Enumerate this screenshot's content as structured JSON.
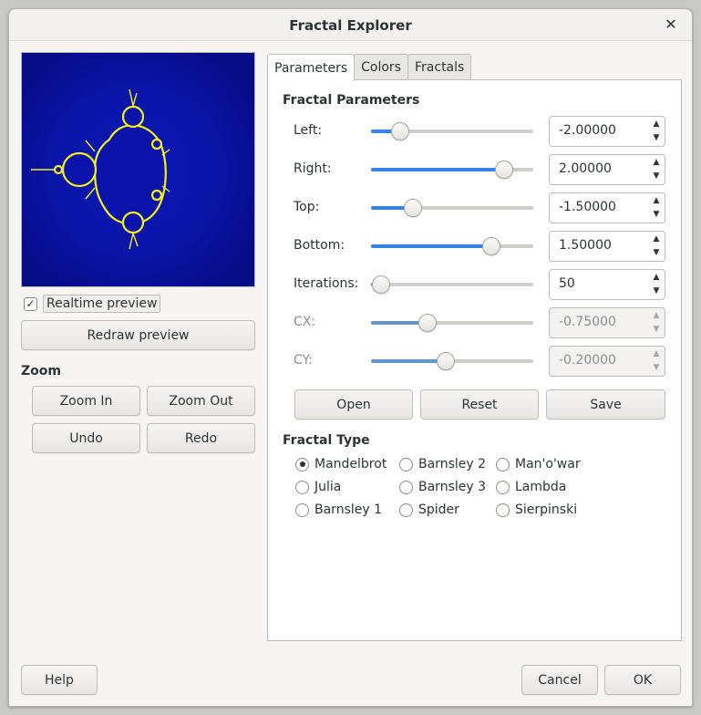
{
  "window": {
    "title": "Fractal Explorer"
  },
  "preview": {
    "realtime_label": "Realtime preview",
    "realtime_checked": true,
    "redraw_label": "Redraw preview"
  },
  "zoom": {
    "title": "Zoom",
    "zoom_in": "Zoom In",
    "zoom_out": "Zoom Out",
    "undo": "Undo",
    "redo": "Redo"
  },
  "tabs": [
    {
      "label": "Parameters",
      "active": true
    },
    {
      "label": "Colors",
      "active": false
    },
    {
      "label": "Fractals",
      "active": false
    }
  ],
  "parameters": {
    "title": "Fractal Parameters",
    "rows": [
      {
        "label": "Left:",
        "value": "-2.00000",
        "level": 0.18,
        "disabled": false
      },
      {
        "label": "Right:",
        "value": "2.00000",
        "level": 0.82,
        "disabled": false
      },
      {
        "label": "Top:",
        "value": "-1.50000",
        "level": 0.26,
        "disabled": false
      },
      {
        "label": "Bottom:",
        "value": "1.50000",
        "level": 0.74,
        "disabled": false
      },
      {
        "label": "Iterations:",
        "value": "50",
        "level": 0.06,
        "disabled": false
      },
      {
        "label": "CX:",
        "value": "-0.75000",
        "level": 0.35,
        "disabled": true
      },
      {
        "label": "CY:",
        "value": "-0.20000",
        "level": 0.46,
        "disabled": true
      }
    ],
    "open": "Open",
    "reset": "Reset",
    "save": "Save"
  },
  "fractal_type": {
    "title": "Fractal Type",
    "options": [
      {
        "label": "Mandelbrot",
        "checked": true
      },
      {
        "label": "Barnsley 2",
        "checked": false
      },
      {
        "label": "Man'o'war",
        "checked": false
      },
      {
        "label": "Julia",
        "checked": false
      },
      {
        "label": "Barnsley 3",
        "checked": false
      },
      {
        "label": "Lambda",
        "checked": false
      },
      {
        "label": "Barnsley 1",
        "checked": false
      },
      {
        "label": "Spider",
        "checked": false
      },
      {
        "label": "Sierpinski",
        "checked": false
      }
    ]
  },
  "footer": {
    "help": "Help",
    "cancel": "Cancel",
    "ok": "OK"
  },
  "colors": {
    "accent": "#3584e4",
    "preview_bg": "#070c8b",
    "fractal_edge": "#f2f21a"
  }
}
